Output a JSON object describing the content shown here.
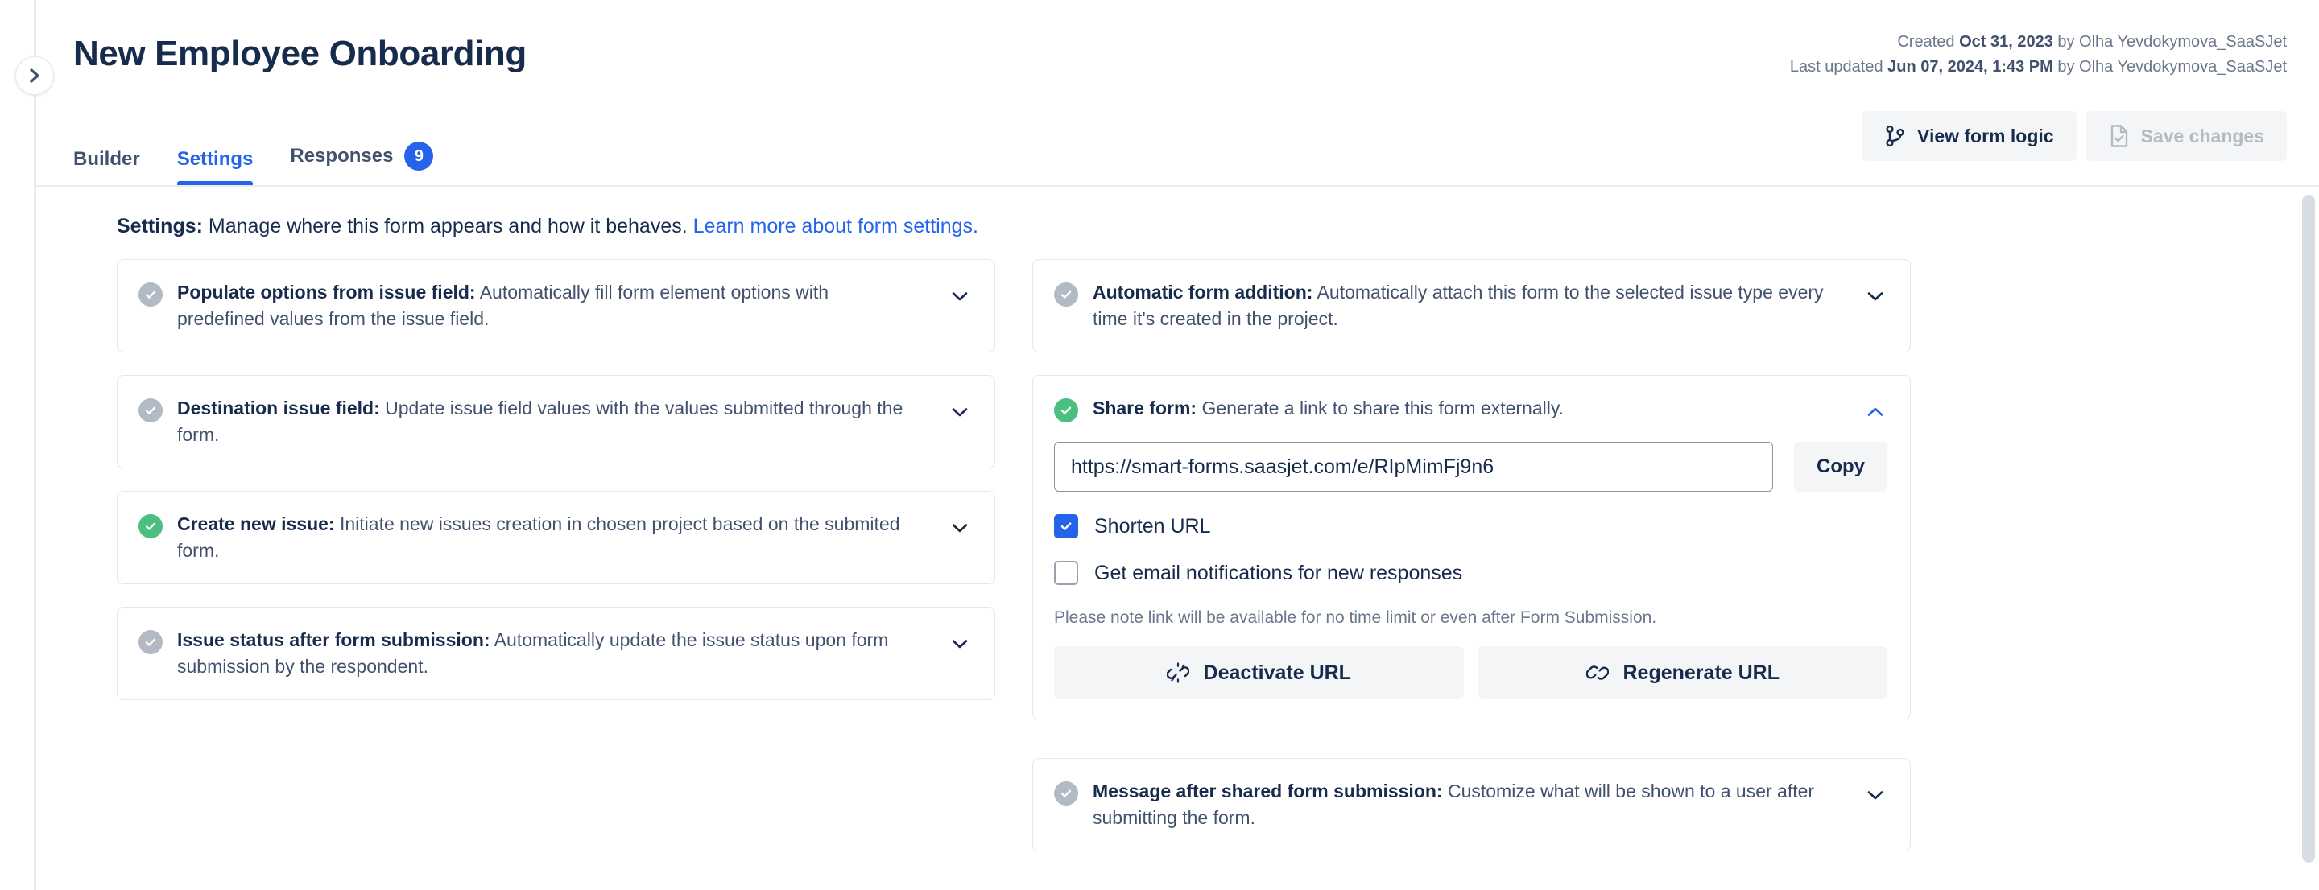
{
  "window": {
    "title": "New Employee Onboarding"
  },
  "header": {
    "title": "New Employee Onboarding",
    "collapse_icon": "chevron-right-icon",
    "meta": {
      "created_prefix": "Created ",
      "created_date": "Oct 31, 2023",
      "created_suffix": " by Olha Yevdokymova_SaaSJet",
      "updated_prefix": "Last updated ",
      "updated_date": "Jun 07, 2024, 1:43 PM",
      "updated_suffix": " by Olha Yevdokymova_SaaSJet"
    },
    "actions": [
      {
        "label": "View form logic",
        "icon": "form-logic-branch-icon",
        "disabled": false
      },
      {
        "label": "Save changes",
        "icon": "document-check-icon",
        "disabled": true
      }
    ]
  },
  "tabs": [
    {
      "label": "Builder",
      "active": false,
      "badge": null
    },
    {
      "label": "Settings",
      "active": true,
      "badge": null
    },
    {
      "label": "Responses",
      "active": false,
      "badge": "9"
    }
  ],
  "intro": {
    "label": "Settings:",
    "text": " Manage where this form appears and how it behaves. ",
    "link": "Learn more about form settings."
  },
  "left_column": [
    {
      "title": "Populate options from issue field:",
      "description": " Automatically fill form element options with predefined values from the issue field.",
      "enabled": false,
      "expanded": false,
      "chevron": "chevron-down-icon"
    },
    {
      "title": "Destination issue field:",
      "description": " Update issue field values with the values submitted through the form.",
      "enabled": false,
      "expanded": false,
      "chevron": "chevron-down-icon"
    },
    {
      "title": "Create new issue:",
      "description": " Initiate new issues creation in chosen project based on the submited form.",
      "enabled": true,
      "expanded": false,
      "chevron": "chevron-down-icon"
    },
    {
      "title": "Issue status after form submission:",
      "description": " Automatically update the issue status upon form submission by the respondent.",
      "enabled": false,
      "expanded": false,
      "chevron": "chevron-down-icon"
    }
  ],
  "right_column": {
    "automatic_form_addition": {
      "title": "Automatic form addition:",
      "description": " Automatically attach this form to the selected issue type every time it's created in the project.",
      "enabled": false,
      "expanded": false,
      "chevron": "chevron-down-icon"
    },
    "share_form": {
      "title": "Share form:",
      "description": " Generate a link to share this form externally.",
      "enabled": true,
      "expanded": true,
      "chevron": "chevron-up-icon",
      "url_value": "https://smart-forms.saasjet.com/e/RIpMimFj9n6",
      "url_placeholder": "https://smart-forms.saasjet.com/e/",
      "copy_label": "Copy",
      "shorten_url": {
        "label": "Shorten URL",
        "checked": true
      },
      "email_notifications": {
        "label": "Get email notifications for new responses",
        "checked": false
      },
      "note": "Please note link will be available for no time limit or even after Form Submission.",
      "actions": [
        {
          "label": "Deactivate URL",
          "icon": "broken-link-icon"
        },
        {
          "label": "Regenerate URL",
          "icon": "link-icon"
        }
      ]
    },
    "message_after_submission": {
      "title": "Message after shared form submission:",
      "description": " Customize what will be shown to a user after submitting the form.",
      "enabled": false,
      "expanded": false,
      "chevron": "chevron-down-icon"
    }
  },
  "colors": {
    "accent": "#2563eb",
    "success": "#4bbf7f",
    "muted": "#b3bac5",
    "text": "#172b4d",
    "subtext": "#42526e"
  }
}
